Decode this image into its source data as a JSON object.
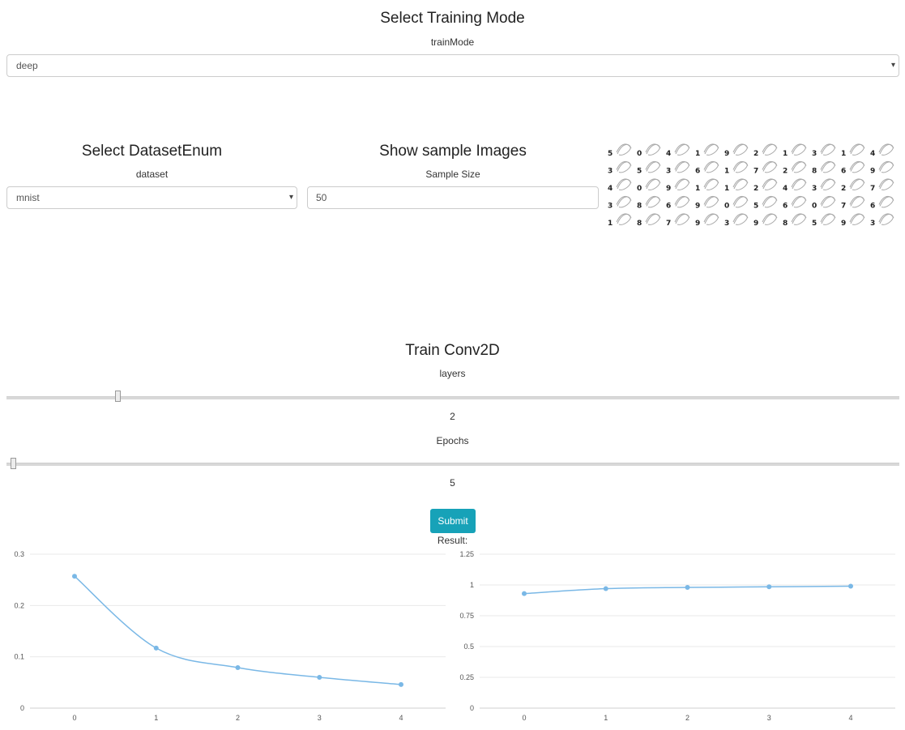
{
  "mode": {
    "title": "Select Training Mode",
    "label": "trainMode",
    "value": "deep"
  },
  "dataset": {
    "title": "Select DatasetEnum",
    "label": "dataset",
    "value": "mnist"
  },
  "samples": {
    "title": "Show sample Images",
    "label": "Sample Size",
    "value": "50",
    "digits": [
      [
        "5",
        "0",
        "4",
        "1",
        "9",
        "2",
        "1",
        "3",
        "1",
        "4"
      ],
      [
        "3",
        "5",
        "3",
        "6",
        "1",
        "7",
        "2",
        "8",
        "6",
        "9"
      ],
      [
        "4",
        "0",
        "9",
        "1",
        "1",
        "2",
        "4",
        "3",
        "2",
        "7"
      ],
      [
        "3",
        "8",
        "6",
        "9",
        "0",
        "5",
        "6",
        "0",
        "7",
        "6"
      ],
      [
        "1",
        "8",
        "7",
        "9",
        "3",
        "9",
        "8",
        "5",
        "9",
        "3"
      ]
    ]
  },
  "train": {
    "title": "Train Conv2D",
    "layers_label": "layers",
    "layers_value": "2",
    "layers_fraction": 0.12,
    "epochs_label": "Epochs",
    "epochs_value": "5",
    "epochs_fraction": 0.0,
    "submit_label": "Submit",
    "result_label": "Result:"
  },
  "colors": {
    "line": "#7ab8e6",
    "accent": "#17a2b8"
  },
  "chart_data": [
    {
      "type": "line",
      "x": [
        0,
        1,
        2,
        3,
        4
      ],
      "values": [
        0.257,
        0.117,
        0.079,
        0.06,
        0.046
      ],
      "ylim": [
        0,
        0.3
      ],
      "yticks": [
        "0",
        "0.1",
        "0.2",
        "0.3"
      ],
      "yticks_values": [
        0,
        0.1,
        0.2,
        0.3
      ],
      "xticks": [
        "0",
        "1",
        "2",
        "3",
        "4"
      ],
      "grid": true,
      "color": "#7ab8e6"
    },
    {
      "type": "line",
      "x": [
        0,
        1,
        2,
        3,
        4
      ],
      "values": [
        0.93,
        0.97,
        0.98,
        0.985,
        0.99
      ],
      "ylim": [
        0,
        1.25
      ],
      "yticks": [
        "0",
        "0.25",
        "0.5",
        "0.75",
        "1",
        "1.25"
      ],
      "yticks_values": [
        0,
        0.25,
        0.5,
        0.75,
        1,
        1.25
      ],
      "xticks": [
        "0",
        "1",
        "2",
        "3",
        "4"
      ],
      "grid": true,
      "color": "#7ab8e6"
    }
  ]
}
